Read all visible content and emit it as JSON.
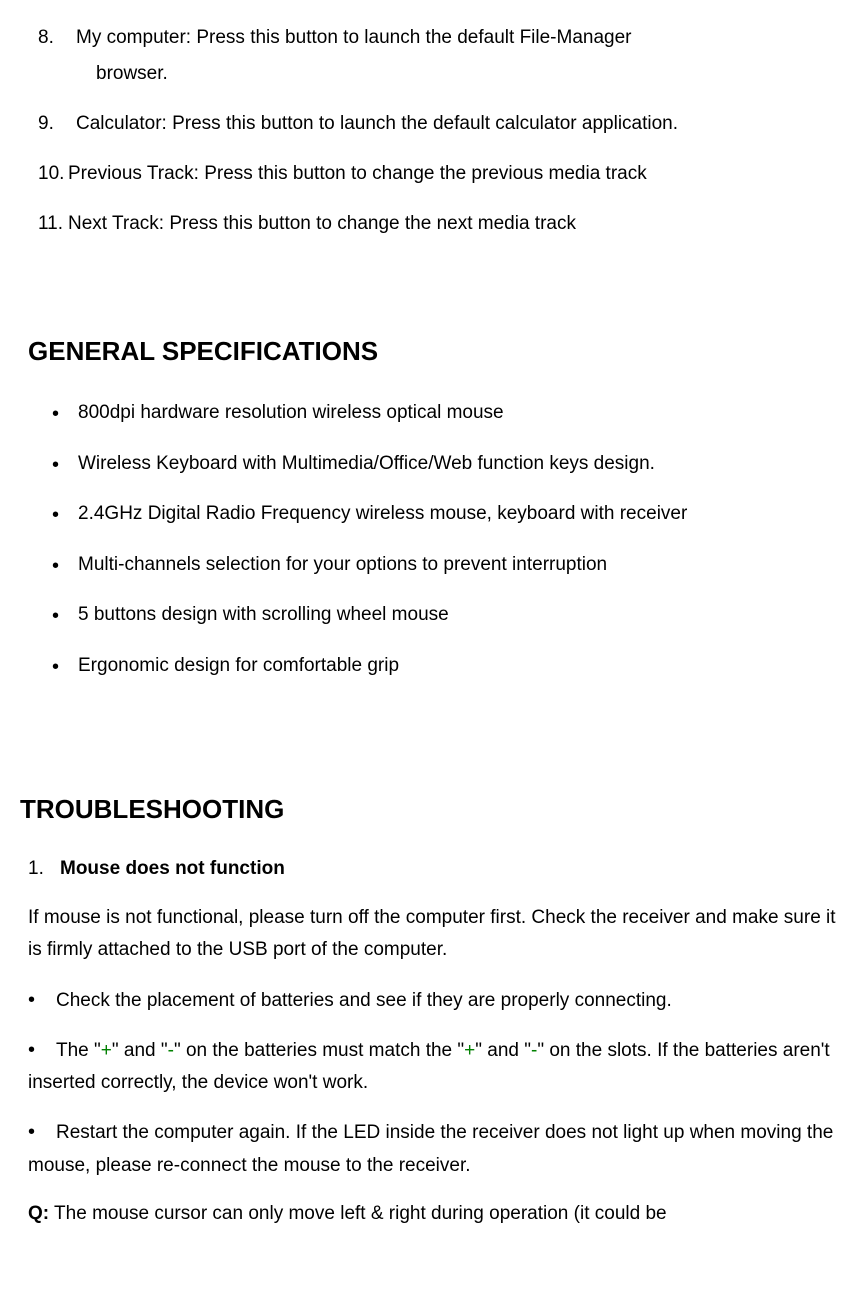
{
  "numberedItems": {
    "item8": {
      "num": "8.",
      "line1": "My computer: Press this button to launch the default File-Manager",
      "line2": "browser."
    },
    "item9": {
      "num": "9.",
      "text": "Calculator: Press this button to launch the default calculator application."
    },
    "item10": {
      "num": "10.",
      "text": "Previous Track: Press this button to change the previous media track"
    },
    "item11": {
      "num": "11.",
      "text": "Next Track: Press this button to change the next media track"
    }
  },
  "specsHeading": "GENERAL SPECIFICATIONS",
  "specs": [
    "800dpi hardware resolution wireless optical mouse",
    "Wireless Keyboard with Multimedia/Office/Web function keys design.",
    "2.4GHz Digital Radio Frequency wireless mouse, keyboard with receiver",
    "Multi-channels selection for your options to prevent interruption",
    "5 buttons design with scrolling wheel mouse",
    "Ergonomic design for comfortable grip"
  ],
  "troubleshootHeading": "TROUBLESHOOTING",
  "ts": {
    "item1": {
      "num": "1.",
      "title": "Mouse does not function"
    },
    "para1": "If mouse is not functional, please turn off the computer first.   Check the receiver and make sure it is firmly attached to the USB port of the computer.",
    "bullet1": "Check the placement of batteries and see if they are properly connecting.",
    "bullet2": {
      "pre": "The \"",
      "plus1": "+",
      "mid1": "\" and \"",
      "minus1": "-",
      "mid2": "\" on the batteries must match the \"",
      "plus2": "+",
      "mid3": "\" and \"",
      "minus2": "-",
      "post": "\" on the slots. If the batteries aren't inserted correctly, the device won't work."
    },
    "bullet3": "Restart the computer again. If the LED inside the receiver does not light up when moving the mouse, please re-connect the mouse to the receiver.",
    "qLabel": "Q:",
    "qText": " The mouse cursor can only move left & right during operation (it could be"
  }
}
